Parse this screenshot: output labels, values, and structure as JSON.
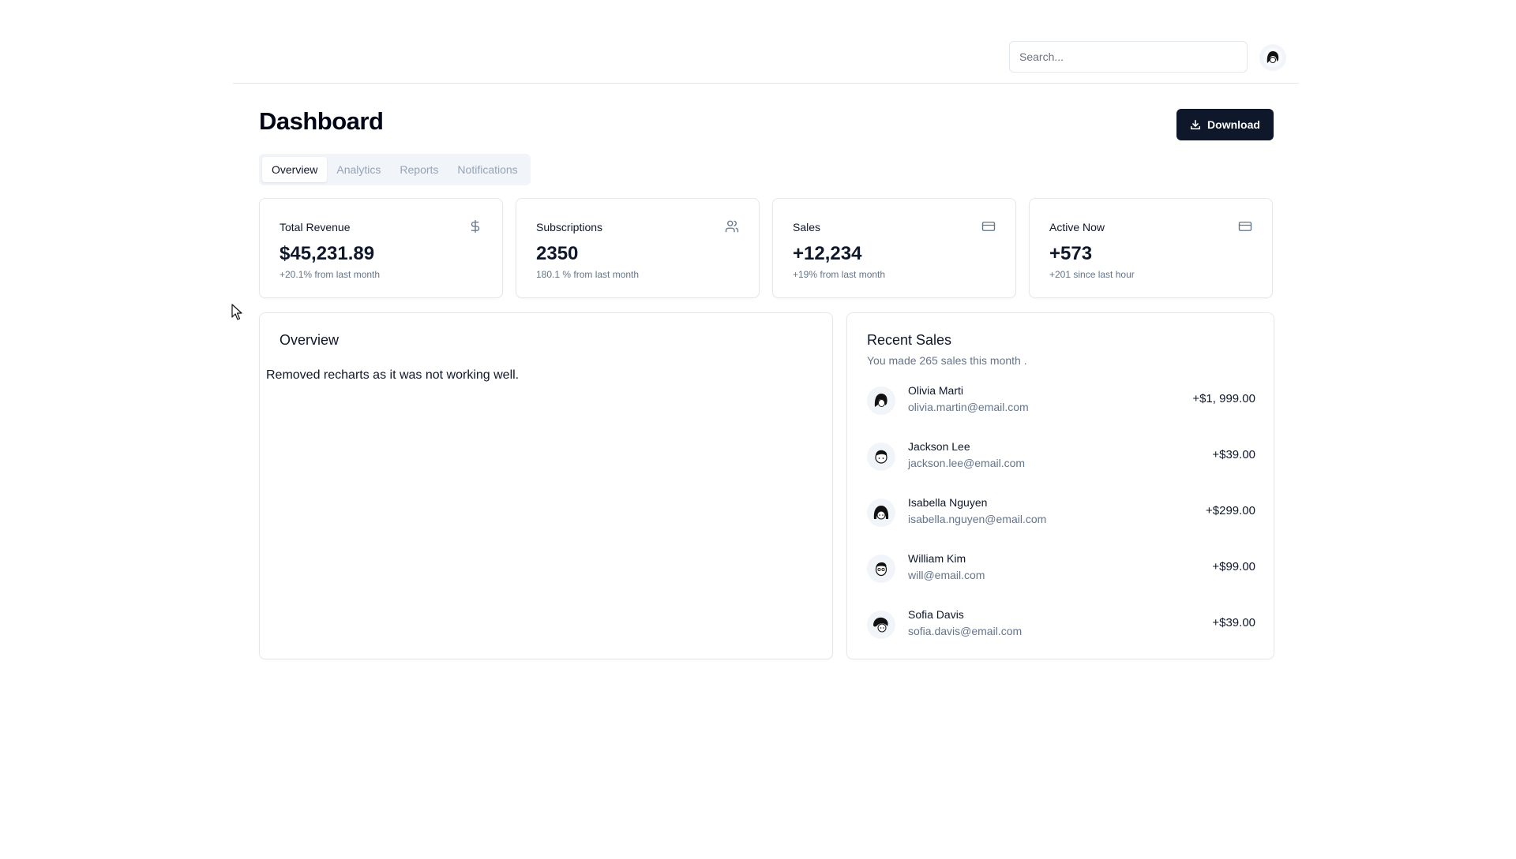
{
  "header": {
    "search_placeholder": "Search...",
    "search_value": "",
    "user_avatar_icon": "user-avatar-icon"
  },
  "page": {
    "title": "Dashboard",
    "download_label": "Download",
    "download_icon": "download-icon"
  },
  "tabs": [
    {
      "label": "Overview",
      "active": true
    },
    {
      "label": "Analytics",
      "active": false
    },
    {
      "label": "Reports",
      "active": false
    },
    {
      "label": "Notifications",
      "active": false
    }
  ],
  "stats": [
    {
      "label": "Total Revenue",
      "value": "$45,231.89",
      "sub": "+20.1% from last month",
      "icon": "dollar-icon"
    },
    {
      "label": "Subscriptions",
      "value": "2350",
      "sub": "180.1 % from last month",
      "icon": "users-icon"
    },
    {
      "label": "Sales",
      "value": "+12,234",
      "sub": "+19% from last month",
      "icon": "credit-card-icon"
    },
    {
      "label": "Active Now",
      "value": "+573",
      "sub": "+201 since last hour",
      "icon": "credit-card-icon"
    }
  ],
  "overview": {
    "title": "Overview",
    "message": "Removed recharts as it was not working well."
  },
  "recent_sales": {
    "title": "Recent Sales",
    "subtitle": "You made 265 sales this month .",
    "items": [
      {
        "name": "Olivia Marti",
        "email": "olivia.martin@email.com",
        "amount": "+$1, 999.00"
      },
      {
        "name": "Jackson Lee",
        "email": "jackson.lee@email.com",
        "amount": "+$39.00"
      },
      {
        "name": "Isabella Nguyen",
        "email": "isabella.nguyen@email.com",
        "amount": "+$299.00"
      },
      {
        "name": "William Kim",
        "email": "will@email.com",
        "amount": "+$99.00"
      },
      {
        "name": "Sofia Davis",
        "email": "sofia.davis@email.com",
        "amount": "+$39.00"
      }
    ]
  },
  "colors": {
    "primary": "#0f172a",
    "muted_text": "#64748b",
    "border": "#e5e7eb",
    "tab_bg": "#f1f5f9"
  }
}
